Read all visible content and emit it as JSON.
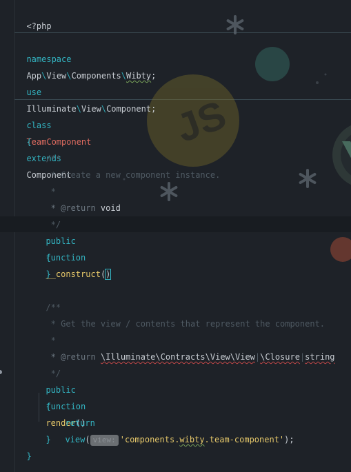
{
  "editor": {
    "line_open": "<?php",
    "namespace": {
      "keyword": "namespace",
      "parts": [
        "App",
        "View",
        "Components",
        "Wibty"
      ],
      "sep": "\\",
      "end": ";"
    },
    "use": {
      "keyword": "use",
      "parts": [
        "Illuminate",
        "View",
        "Component"
      ],
      "sep": "\\",
      "end": ";"
    },
    "class_decl": {
      "keyword": "class",
      "name": "TeamComponent",
      "extends_keyword": "extends",
      "parent": "Component"
    },
    "open_brace": "{",
    "close_brace": "}",
    "doc1": {
      "open": "/**",
      "text": " * Create a new component instance.",
      "star": " *",
      "return_tag": " * @return",
      "return_type": " void",
      "close": " */"
    },
    "construct": {
      "public": "public",
      "function": "function",
      "name": "__construct",
      "paren_open": "(",
      "paren_close": ")",
      "open": "{",
      "close": "}"
    },
    "doc2": {
      "open": "/**",
      "text": " * Get the view / contents that represent the component.",
      "star": " *",
      "return_tag": " * @return",
      "return_type_1": "\\Illuminate\\Contracts\\View\\View",
      "pipe": "|",
      "return_type_2": "\\Closure",
      "return_type_3": "string",
      "close": " */"
    },
    "render": {
      "public": "public",
      "function": "function",
      "name": "render",
      "parens": "()",
      "open": "{",
      "close": "}",
      "return_kw": "return",
      "call": "view",
      "paren_open": "(",
      "hint": "view:",
      "string_pre": "'components.",
      "string_word": "wibty",
      "string_post": ".team-component'",
      "paren_close": ");"
    }
  },
  "colors": {
    "background": "#1e2228",
    "keyword": "#33b5c3",
    "class_name": "#e06c60",
    "function_name": "#e6c86a",
    "string": "#e6c86a",
    "comment": "#4f5a63"
  },
  "decorations": [
    "js-logo",
    "snowflake-icon",
    "vue-logo"
  ]
}
